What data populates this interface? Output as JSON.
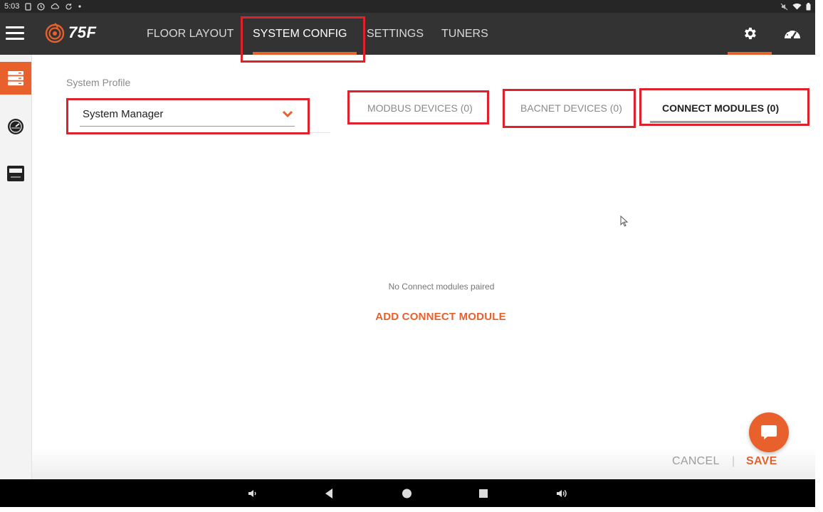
{
  "status_bar": {
    "time": "5:03"
  },
  "app": {
    "brand": "75F"
  },
  "nav": {
    "tabs": [
      {
        "label": "FLOOR LAYOUT"
      },
      {
        "label": "SYSTEM CONFIG"
      },
      {
        "label": "SETTINGS"
      },
      {
        "label": "TUNERS"
      }
    ],
    "active_tab": "SYSTEM CONFIG"
  },
  "profile": {
    "label": "System Profile",
    "selected": "System Manager"
  },
  "device_tabs": [
    {
      "label": "MODBUS DEVICES (0)"
    },
    {
      "label": "BACNET DEVICES (0)"
    },
    {
      "label": "CONNECT MODULES (0)"
    }
  ],
  "active_device_tab": "CONNECT MODULES (0)",
  "empty_state": {
    "message": "No Connect modules paired",
    "action": "ADD CONNECT MODULE"
  },
  "footer": {
    "cancel": "CANCEL",
    "separator": "|",
    "save": "SAVE"
  },
  "colors": {
    "accent": "#e8602c",
    "app_bar": "#333333",
    "highlight": "#e0202a"
  }
}
